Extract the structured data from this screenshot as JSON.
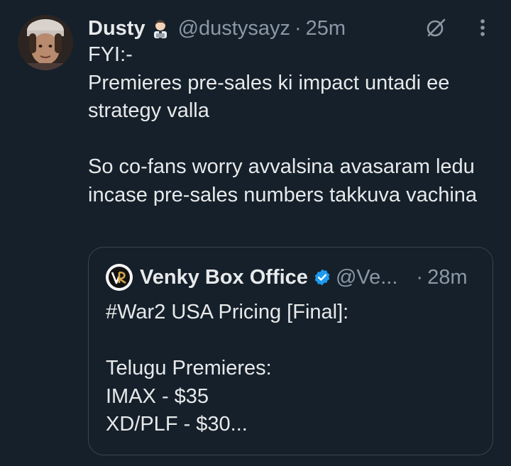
{
  "tweet": {
    "author": {
      "display_name": "Dusty",
      "name_emoji": "technologist-emoji",
      "handle": "@dustysayz",
      "separator": "·",
      "time": "25m"
    },
    "text": "FYI:-\nPremieres pre-sales ki impact untadi ee strategy valla\n\nSo co-fans worry avvalsina avasaram ledu incase pre-sales numbers takkuva vachina",
    "icons": {
      "grok": "grok-icon",
      "more": "more-vertical-icon"
    }
  },
  "quoted_tweet": {
    "author": {
      "display_name": "Venky Box Office",
      "verified": true,
      "handle": "@Ve...",
      "separator": "·",
      "time": "28m"
    },
    "text": "#War2 USA Pricing [Final]:\n\nTelugu Premieres:\nIMAX - $35\nXD/PLF - $30..."
  },
  "colors": {
    "background": "#15202b",
    "primary_text": "#e7e9ea",
    "secondary_text": "#8b98a5",
    "border": "#38444d",
    "verified_blue": "#1d9bf0"
  }
}
